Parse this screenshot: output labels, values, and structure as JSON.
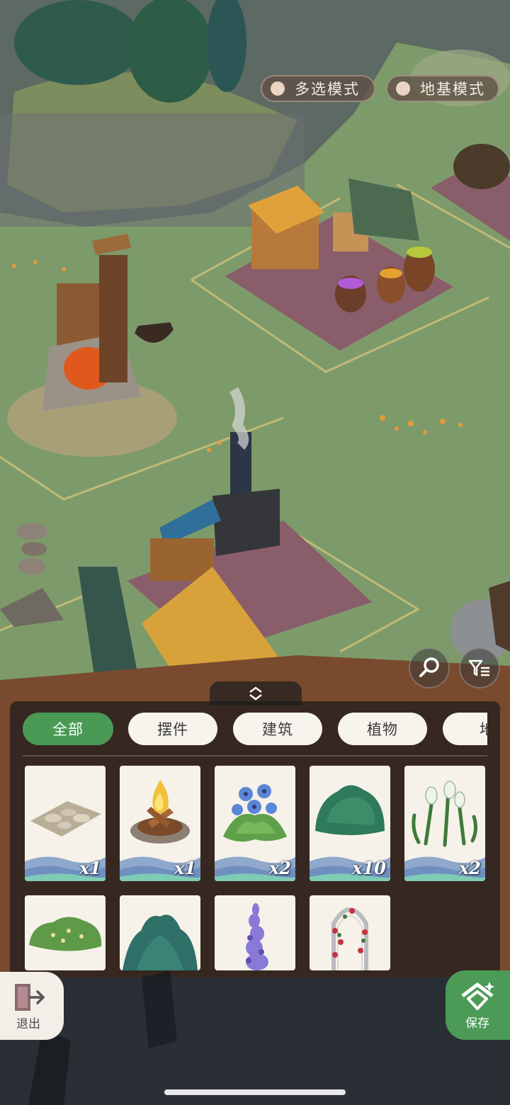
{
  "modes": {
    "multi_select": "多选模式",
    "foundation": "地基模式"
  },
  "tabs": [
    {
      "label": "全部",
      "active": true
    },
    {
      "label": "摆件",
      "active": false
    },
    {
      "label": "建筑",
      "active": false
    },
    {
      "label": "植物",
      "active": false
    },
    {
      "label": "地",
      "active": false
    }
  ],
  "items": [
    {
      "name": "stone-path",
      "qty": "x1"
    },
    {
      "name": "campfire",
      "qty": "x1"
    },
    {
      "name": "blue-flower-bush",
      "qty": "x2"
    },
    {
      "name": "green-shrub",
      "qty": "x10"
    },
    {
      "name": "snowdrop-flowers",
      "qty": "x2"
    },
    {
      "name": "flowering-hedge",
      "qty": ""
    },
    {
      "name": "teal-bush",
      "qty": ""
    },
    {
      "name": "purple-lupine",
      "qty": ""
    },
    {
      "name": "rose-arch",
      "qty": ""
    }
  ],
  "buttons": {
    "exit": "退出",
    "save": "保存"
  },
  "colors": {
    "accent_green": "#4a9a56",
    "tab_bg": "#f7f4ee",
    "panel_bg": "rgba(28,28,28,0.72)"
  }
}
